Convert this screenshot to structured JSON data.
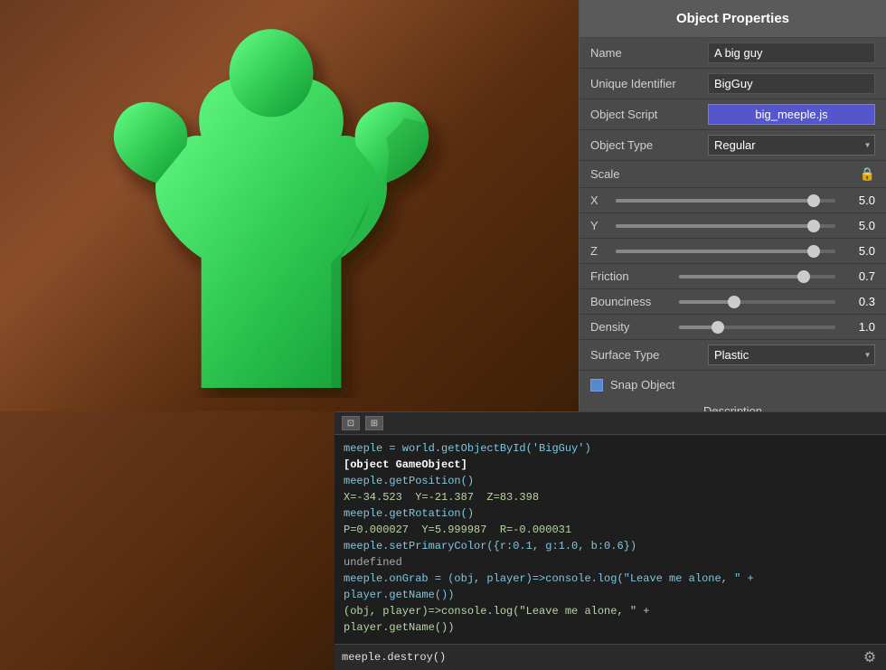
{
  "header": {
    "title": "Object Properties"
  },
  "properties": {
    "name_label": "Name",
    "name_value": "A big guy",
    "uid_label": "Unique Identifier",
    "uid_value": "BigGuy",
    "script_label": "Object Script",
    "script_value": "big_meeple.js",
    "type_label": "Object Type",
    "type_value": "Regular",
    "scale_label": "Scale",
    "x_label": "X",
    "x_value": "5.0",
    "y_label": "Y",
    "y_value": "5.0",
    "z_label": "Z",
    "z_value": "5.0",
    "friction_label": "Friction",
    "friction_value": "0.7",
    "friction_percent": 80,
    "bounciness_label": "Bounciness",
    "bounciness_value": "0.3",
    "bounciness_percent": 35,
    "density_label": "Density",
    "density_value": "1.0",
    "density_percent": 25,
    "surface_label": "Surface Type",
    "surface_value": "Plastic",
    "snap_label": "Snap Object",
    "description_label": "Description"
  },
  "console": {
    "toolbar": {
      "btn1": "⊡",
      "btn2": "⊞"
    },
    "lines": [
      {
        "text": "meeple = world.getObjectById('BigGuy')",
        "style": "normal"
      },
      {
        "text": "[object GameObject]",
        "style": "bold"
      },
      {
        "text": "meeple.getPosition()",
        "style": "normal"
      },
      {
        "text": "X=-34.523  Y=-21.387  Z=83.398",
        "style": "value"
      },
      {
        "text": "meeple.getRotation()",
        "style": "normal"
      },
      {
        "text": "P=0.000027  Y=5.999987  R=-0.000031",
        "style": "value"
      },
      {
        "text": "meeple.setPrimaryColor({r:0.1, g:1.0, b:0.6})",
        "style": "normal"
      },
      {
        "text": "undefined",
        "style": "undefined"
      },
      {
        "text": "meeple.onGrab = (obj, player)=>console.log(\"Leave me alone, \" +",
        "style": "normal"
      },
      {
        "text": "player.getName())",
        "style": "normal"
      },
      {
        "text": "(obj, player)=>console.log(\"Leave me alone, \" +",
        "style": "value"
      },
      {
        "text": "player.getName())",
        "style": "value"
      }
    ],
    "bottom_line": "meeple.destroy()",
    "gear_icon": "⚙"
  },
  "icons": {
    "console_icon1": "⊡",
    "console_icon2": "⊞",
    "lock_icon": "🔒",
    "gear_icon": "⚙",
    "dropdown_arrow": "▾"
  }
}
